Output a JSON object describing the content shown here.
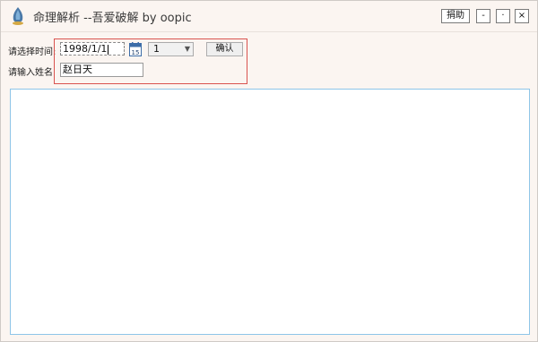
{
  "window": {
    "title": "命理解析 --吾爱破解 by oopic",
    "buttons": {
      "donate": "捐助",
      "minimize": "-",
      "restore": "·",
      "close": "×"
    }
  },
  "form": {
    "date_label": "请选择时间:",
    "date_value": "1998/1/1",
    "calendar_day": "15",
    "hour_value": "1",
    "confirm_label": "确认",
    "name_label": "请输入姓名",
    "name_value": "赵日天"
  },
  "output": {
    "text": ""
  }
}
